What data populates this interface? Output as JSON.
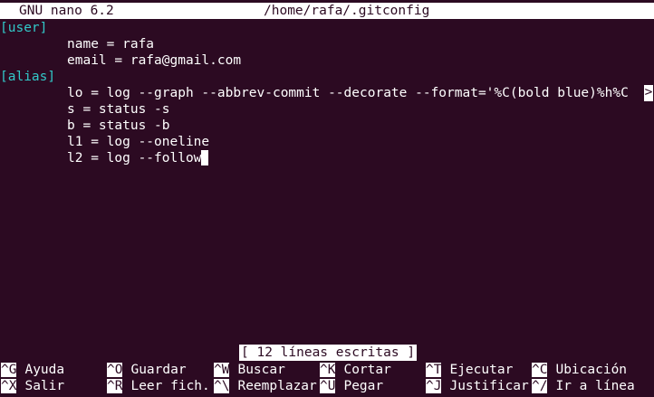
{
  "titlebar": {
    "app_name": "GNU nano 6.2",
    "file_path": "/home/rafa/.gitconfig"
  },
  "editor": {
    "user_section": "[user]",
    "user_lines": [
      "name = rafa",
      "email = rafa@gmail.com"
    ],
    "alias_section": "[alias]",
    "alias_lines": [
      "lo = log --graph --abbrev-commit --decorate --format='%C(bold blue)%h%C",
      "s = status -s",
      "b = status -b",
      "l1 = log --oneline",
      "l2 = log --follow"
    ],
    "overflow_mark": ">"
  },
  "status_message": "[ 12 líneas escritas ]",
  "shortcuts": {
    "row1": [
      {
        "key": "^G",
        "label": "Ayuda"
      },
      {
        "key": "^O",
        "label": "Guardar"
      },
      {
        "key": "^W",
        "label": "Buscar"
      },
      {
        "key": "^K",
        "label": "Cortar"
      },
      {
        "key": "^T",
        "label": "Ejecutar"
      },
      {
        "key": "^C",
        "label": "Ubicación"
      }
    ],
    "row2": [
      {
        "key": "^X",
        "label": "Salir"
      },
      {
        "key": "^R",
        "label": "Leer fich."
      },
      {
        "key": "^\\",
        "label": "Reemplazar"
      },
      {
        "key": "^U",
        "label": "Pegar"
      },
      {
        "key": "^J",
        "label": "Justificar"
      },
      {
        "key": "^/",
        "label": "Ir a línea"
      }
    ]
  }
}
